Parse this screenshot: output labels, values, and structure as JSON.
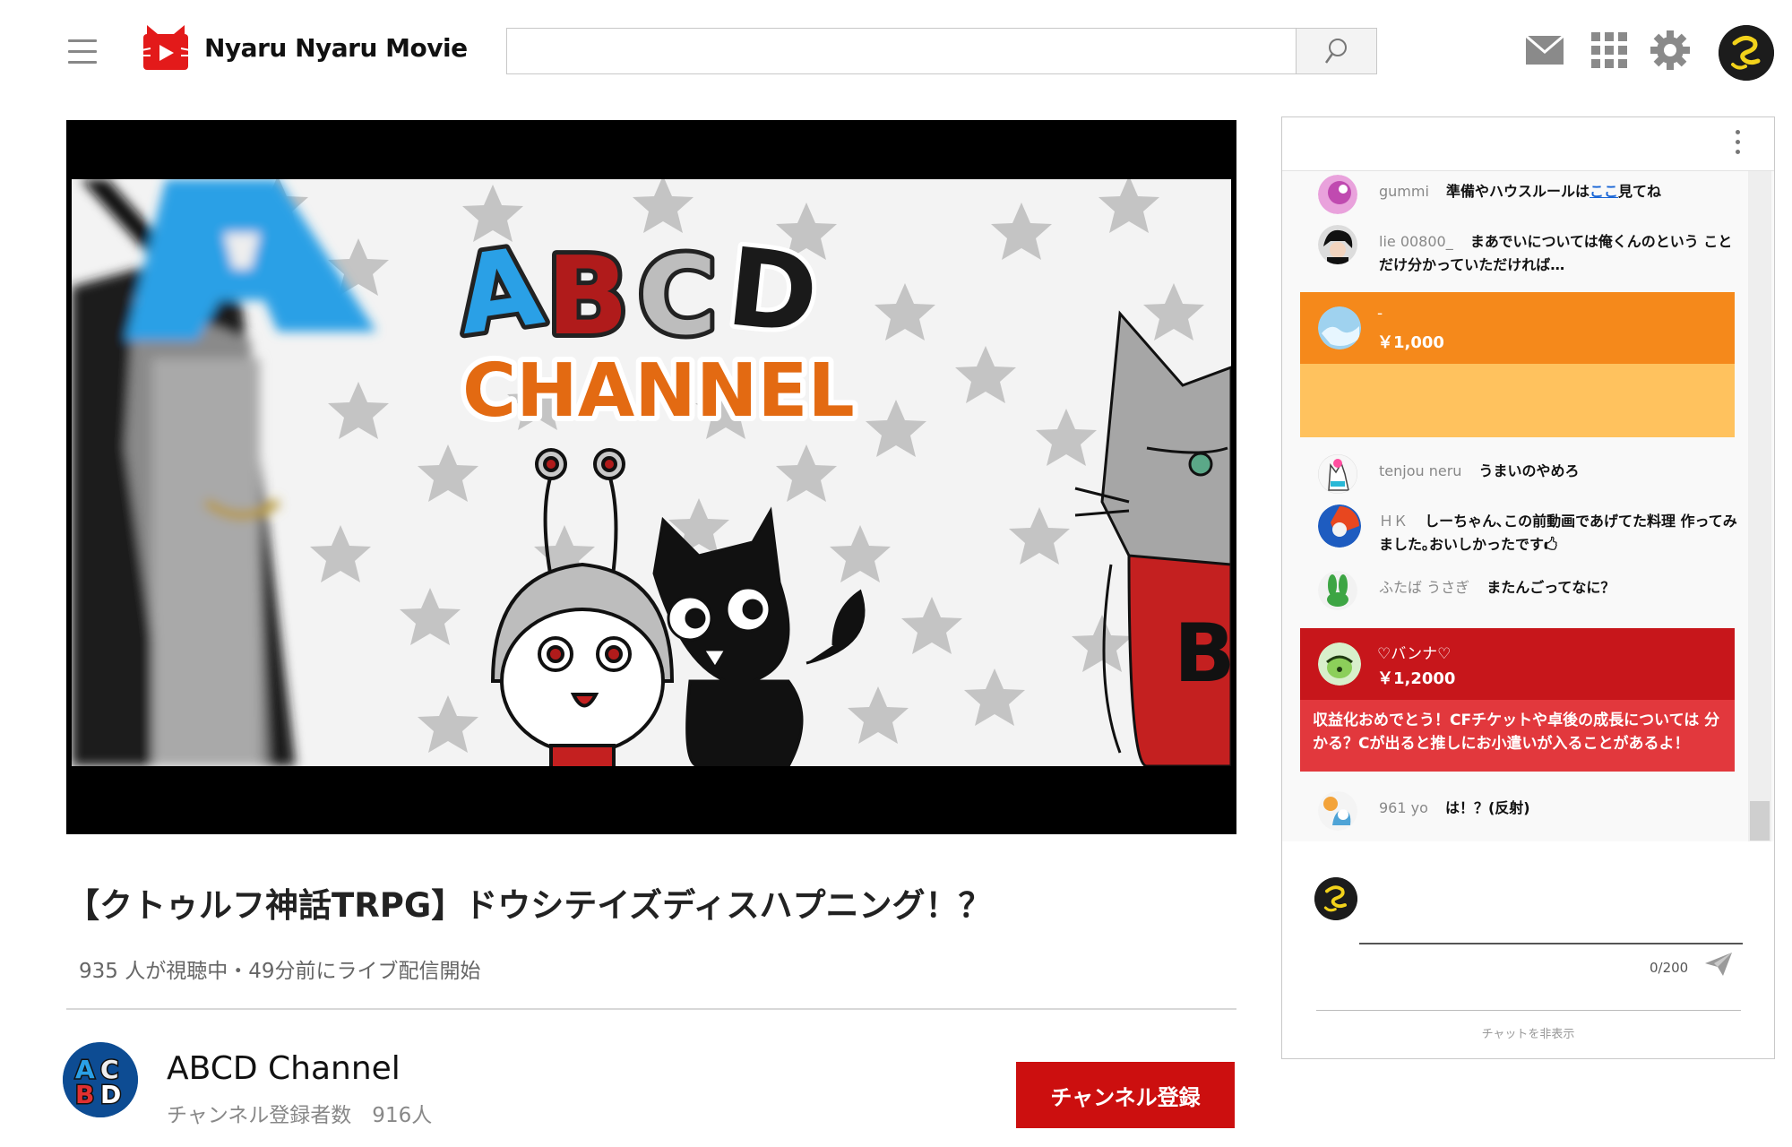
{
  "header": {
    "logo_text": "Nyaru Nyaru Movie",
    "search_placeholder": "",
    "icons": [
      "menu-icon",
      "search-icon",
      "mail-icon",
      "apps-grid-icon",
      "settings-gear-icon",
      "user-avatar"
    ]
  },
  "video": {
    "title": "【クトゥルフ神話TRPG】ドウシテイズディスハプニング！？",
    "meta": "935 人が視聴中・49分前にライブ配信開始",
    "thumbnail": {
      "logo_line1": [
        "A",
        "B",
        "C",
        "D"
      ],
      "logo_line2": "CHANNEL",
      "big_letter": "A",
      "shirt_letter": "B"
    }
  },
  "channel": {
    "name": "ABCD Channel",
    "subscribers": "チャンネル登録者数　916人",
    "subscribe_label": "チャンネル登録",
    "avatar_letters": [
      "A",
      "C",
      "B",
      "D"
    ]
  },
  "chat": {
    "messages": [
      {
        "author": "gummi",
        "text_before": "準備やハウスルールは",
        "link": "ここ",
        "text_after": "見てね"
      },
      {
        "author": "lie 00800_",
        "text": "まあでいについては俺くんのという ことだけ分かっていただければ…"
      },
      {
        "author": "tenjou neru",
        "text": "うまいのやめろ"
      },
      {
        "author": "ＨＫ",
        "text": "しーちゃん､この前動画であげてた料理 作ってみました｡おいしかったです🖒"
      },
      {
        "author": "ふたば うさぎ",
        "text": "またんごってなに？"
      },
      {
        "author": "961 yo",
        "text": "は！？(反射)"
      }
    ],
    "superchats": [
      {
        "author": "-",
        "amount": "￥1,000",
        "header_color": "#f5891b",
        "body_color": "#ffc25e",
        "text": ""
      },
      {
        "author": "♡バンナ♡",
        "amount": "￥1,2000",
        "header_color": "#c7161b",
        "body_color": "#e2383d",
        "text": "収益化おめでとう！CFチケットや卓後の成長については 分かる？Cが出ると推しにお小遣いが入ることがあるよ！"
      }
    ],
    "input_placeholder": "",
    "counter": "0/200",
    "hide_label": "チャットを非表示"
  }
}
